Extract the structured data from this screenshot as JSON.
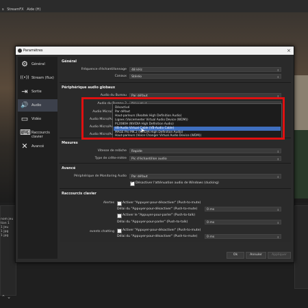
{
  "menubar": {
    "items": [
      "s",
      "StreamFX",
      "Aide (H)"
    ]
  },
  "background": {
    "scene_lines": [
      "nom jeu",
      "tion 1",
      "1 Jeu",
      "1 Jpg",
      "1 jpg"
    ]
  },
  "dialog": {
    "title": "Paramètres",
    "close": "×",
    "sidebar": [
      {
        "label": "Général",
        "icon": "⚙"
      },
      {
        "label": "Stream (flux)",
        "icon": "((•))"
      },
      {
        "label": "Sortie",
        "icon": "⇥"
      },
      {
        "label": "Audio",
        "icon": "🔊"
      },
      {
        "label": "Vidéo",
        "icon": "▭"
      },
      {
        "label": "Raccourcis clavier",
        "icon": "⌨"
      },
      {
        "label": "Avancé",
        "icon": "✕"
      }
    ],
    "sections": {
      "general": {
        "title": "Général",
        "sample_rate_label": "Fréquence d'échantillonnage",
        "sample_rate_value": "48 kHz",
        "channels_label": "Canaux",
        "channels_value": "Stéréo"
      },
      "devices": {
        "title": "Périphérique audio globaux",
        "labels": [
          "Audio du Bureau",
          "Audio du Bureau 2",
          "Audio Micro/Auxiliaire",
          "Audio Micro/Auxiliaire 2",
          "Audio Micro/Auxiliaire 3",
          "Audio Micro/Auxiliaire 4"
        ],
        "desktop_value": "Par défaut",
        "desktop2_value": "Désactivé"
      },
      "meters": {
        "title": "Mesures",
        "decay_label": "Vitesse de relâche",
        "decay_value": "Rapide",
        "peak_label": "Type de crête-mètre",
        "peak_value": "Pic d'échantillon audio"
      },
      "advanced": {
        "title": "Avancé",
        "monitor_label": "Périphérique de Monitoring Audio",
        "monitor_value": "Par défaut",
        "ducking_label": "Désactiver l'atténuation audio de Windows (ducking)"
      },
      "hotkeys": {
        "title": "Raccourcis clavier",
        "rows": [
          {
            "source": "Alertes",
            "enable_ptm": "Activer \"Appuyer-pour-désactiver\" (Push-to-mute)",
            "ptm_delay": "Délai du \"Appuyer-pour-désactiver\" (Push-to-mute)",
            "enable_ptt": "Activer le \"Appuyer-pour-parler\" (Push-to-talk)",
            "ptt_delay": "Délai du \"Appuyer-pour-parler\" (Push-to-talk)",
            "ms": "0 ms"
          },
          {
            "source": "events chatting",
            "enable_ptm": "Activer \"Appuyer-pour-désactiver\" (Push-to-mute)",
            "ptm_delay": "Délai du \"Appuyer-pour-désactiver\" (Push-to-mute)",
            "ms": "0 ms"
          }
        ]
      }
    },
    "dropdown_options": [
      "Désactivé",
      "Par défaut",
      "Haut-parleurs (Realtek High Definition Audio)",
      "Lignes (Voicemeeter Virtual Audio Device (WDM))",
      "PL2080H (NVIDIA High Definition Audio)",
      "VB-Audio Virtual Cable (VB-Audio Cable)",
      "MAGE Pro MK.2 (NVIDIA High Definition Audio)",
      "Haut-parleurs (Voice Changer Virtual Audio Device (WDM))"
    ],
    "selected_option_index": 5,
    "buttons": {
      "ok": "Ok",
      "cancel": "Annuler",
      "apply": "Appliquer"
    }
  }
}
